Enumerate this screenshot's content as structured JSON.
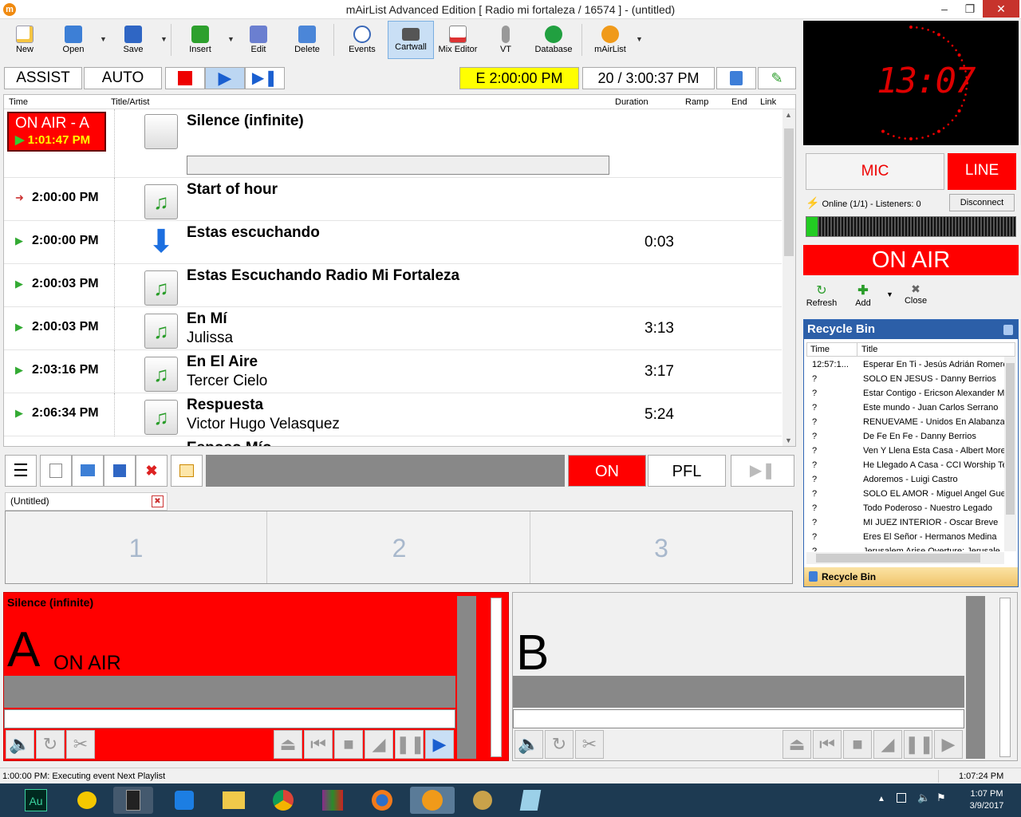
{
  "window": {
    "title": "mAirList Advanced Edition [ Radio mi fortaleza / 16574 ] - (untitled)",
    "icon_label": "m"
  },
  "toolbar": {
    "new": "New",
    "open": "Open",
    "save": "Save",
    "insert": "Insert",
    "edit": "Edit",
    "delete": "Delete",
    "events": "Events",
    "cartwall": "Cartwall",
    "mix_editor": "Mix Editor",
    "vt": "VT",
    "database": "Database",
    "mairlist": "mAirList"
  },
  "controls": {
    "assist": "ASSIST",
    "auto": "AUTO",
    "event_time": "E  2:00:00 PM",
    "count_time": "20 / 3:00:37 PM"
  },
  "playlist": {
    "headers": {
      "time": "Time",
      "title": "Title/Artist",
      "duration": "Duration",
      "ramp": "Ramp",
      "end": "End",
      "link": "Link"
    },
    "onair_label": "ON AIR - A",
    "onair_time": "1:01:47 PM",
    "rows": [
      {
        "time": "",
        "title": "Silence (infinite)",
        "artist": "",
        "duration": ""
      },
      {
        "time": "2:00:00 PM",
        "title": "Start of hour",
        "artist": "",
        "duration": ""
      },
      {
        "time": "2:00:00 PM",
        "title": "Estas escuchando",
        "artist": "",
        "duration": "0:03"
      },
      {
        "time": "2:00:03 PM",
        "title": "Estas Escuchando Radio Mi Fortaleza",
        "artist": "",
        "duration": ""
      },
      {
        "time": "2:00:03 PM",
        "title": "En Mí",
        "artist": "Julissa",
        "duration": "3:13"
      },
      {
        "time": "2:03:16 PM",
        "title": "En El Aire",
        "artist": "Tercer Cielo",
        "duration": "3:17"
      },
      {
        "time": "2:06:34 PM",
        "title": "Respuesta",
        "artist": "Victor Hugo Velasquez",
        "duration": "5:24"
      }
    ],
    "partial_title": "Esposo Mío"
  },
  "cart": {
    "on": "ON",
    "pfl": "PFL",
    "tab": "(Untitled)",
    "slots": [
      "1",
      "2",
      "3"
    ]
  },
  "playerA": {
    "title": "Silence (infinite)",
    "letter": "A",
    "state": "ON AIR"
  },
  "playerB": {
    "letter": "B"
  },
  "clock": {
    "time": "13:07"
  },
  "studio": {
    "mic": "MIC",
    "line": "LINE",
    "online": "Online (1/1) - Listeners: 0",
    "disconnect": "Disconnect",
    "onair": "ON AIR",
    "refresh": "Refresh",
    "add": "Add",
    "close": "Close"
  },
  "recycle": {
    "title": "Recycle Bin",
    "col_time": "Time",
    "col_title": "Title",
    "footer": "Recycle Bin",
    "items": [
      {
        "time": "12:57:1...",
        "title": "Esperar En Ti - Jesús Adrián Romero"
      },
      {
        "time": "?",
        "title": "SOLO EN JESUS - Danny Berrios"
      },
      {
        "time": "?",
        "title": "Estar Contigo - Ericson Alexander M..."
      },
      {
        "time": "?",
        "title": "Este mundo - Juan Carlos Serrano"
      },
      {
        "time": "?",
        "title": "RENUEVAME - Unidos En Alabanza"
      },
      {
        "time": "?",
        "title": "De Fe En Fe - Danny Berrios"
      },
      {
        "time": "?",
        "title": "Ven Y Llena Esta Casa - Albert Morer"
      },
      {
        "time": "?",
        "title": "He Llegado A Casa - CCI Worship Te"
      },
      {
        "time": "?",
        "title": "Adoremos - Luigi Castro"
      },
      {
        "time": "?",
        "title": "SOLO EL AMOR - Miguel Angel Guerra"
      },
      {
        "time": "?",
        "title": "Todo Poderoso - Nuestro Legado"
      },
      {
        "time": "?",
        "title": "MI JUEZ INTERIOR - Oscar Breve"
      },
      {
        "time": "?",
        "title": "Eres El Señor - Hermanos Medina"
      },
      {
        "time": "?",
        "title": "Jerusalem Arise Overture: Jerusale"
      }
    ]
  },
  "status": {
    "message": "1:00:00 PM: Executing event Next Playlist",
    "time": "1:07:24 PM"
  },
  "taskbar": {
    "time": "1:07 PM",
    "date": "3/9/2017",
    "au": "Au"
  }
}
